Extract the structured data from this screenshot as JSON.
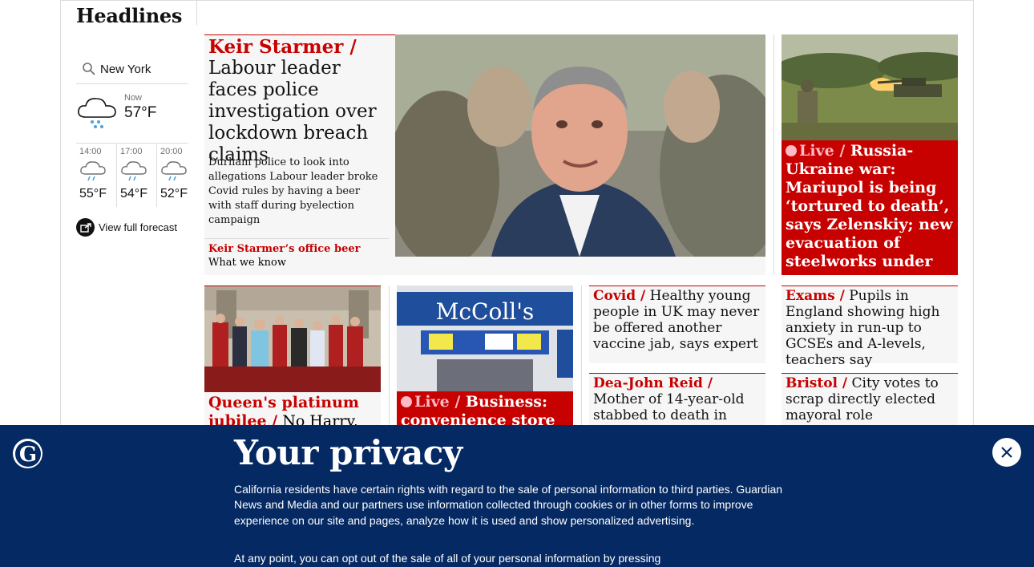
{
  "section": {
    "title": "Headlines"
  },
  "weather": {
    "city": "New York",
    "now_label": "Now",
    "now_temp": "57°F",
    "forecast": [
      {
        "time": "14:00",
        "temp": "55°F"
      },
      {
        "time": "17:00",
        "temp": "54°F"
      },
      {
        "time": "20:00",
        "temp": "52°F"
      }
    ],
    "link_label": "View full forecast"
  },
  "lead": {
    "kicker": "Keir Starmer /",
    "headline": "Labour leader faces police investigation over lockdown breach claims",
    "standfirst": "Durham police to look into allegations Labour leader broke Covid rules by having a beer with staff during byelection campaign",
    "sublink_kicker": "Keir Starmer’s office beer",
    "sublink_text": "What we know"
  },
  "live_card": {
    "live": "Live /",
    "headline": "Russia-Ukraine war: Mariupol is being ‘tortured to death’, says Zelenskiy; new evacuation of steelworks under way"
  },
  "card_jubilee": {
    "kicker": "Queen's platinum jubilee /",
    "headline": "No Harry,"
  },
  "card_business": {
    "live": "Live /",
    "headline": "Business: convenience store",
    "shop_sign": "McColl's"
  },
  "small_cards": [
    {
      "kicker": "Covid /",
      "headline": "Healthy young people in UK may never be offered another vaccine jab, says expert"
    },
    {
      "kicker": "Exams /",
      "headline": "Pupils in England showing high anxiety in run-up to GCSEs and A-levels, teachers say"
    },
    {
      "kicker": "Dea-John Reid /",
      "headline": "Mother of 14-year-old stabbed to death in Birmingham says"
    },
    {
      "kicker": "Bristol /",
      "headline": "City votes to scrap directly elected mayoral role"
    }
  ],
  "privacy": {
    "title": "Your privacy",
    "body": "California residents have certain rights with regard to the sale of personal information to third parties. Guardian News and Media and our partners use information collected through cookies or in other forms to improve experience on our site and pages, analyze how it is used and show personalized advertising.",
    "body2": "At any point, you can opt out of the sale of all of your personal information by pressing"
  }
}
